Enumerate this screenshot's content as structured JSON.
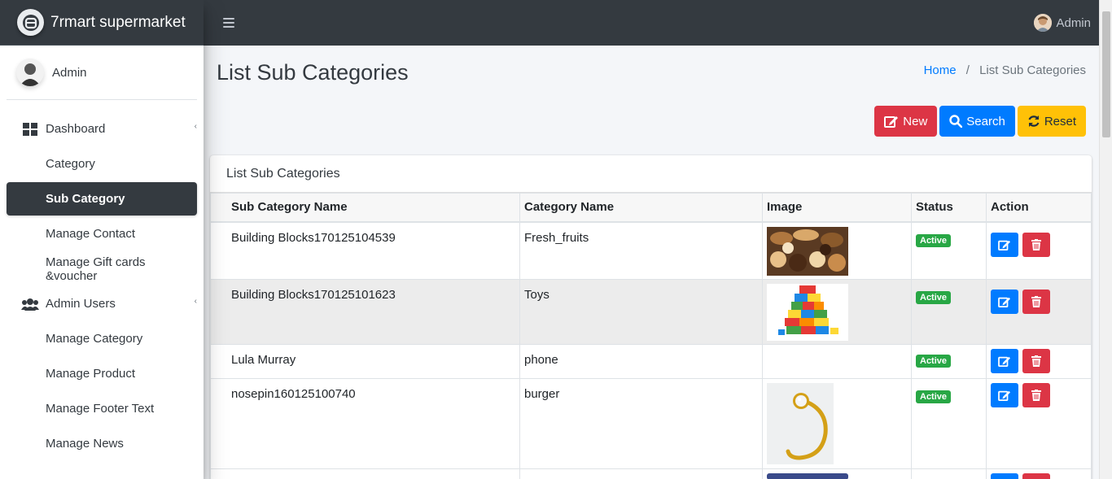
{
  "brand": {
    "name": "7rmart supermarket"
  },
  "user": {
    "name": "Admin"
  },
  "topbar": {
    "user_name": "Admin"
  },
  "sidebar": {
    "items": [
      {
        "label": "Dashboard",
        "type": "parent",
        "icon": "dashboard-icon"
      },
      {
        "label": "Category",
        "type": "child"
      },
      {
        "label": "Sub Category",
        "type": "child",
        "active": true
      },
      {
        "label": "Manage Contact",
        "type": "child"
      },
      {
        "label": "Manage Gift cards &voucher",
        "type": "child"
      },
      {
        "label": "Admin Users",
        "type": "parent",
        "icon": "users-icon"
      },
      {
        "label": "Manage Category",
        "type": "child"
      },
      {
        "label": "Manage Product",
        "type": "child"
      },
      {
        "label": "Manage Footer Text",
        "type": "child"
      },
      {
        "label": "Manage News",
        "type": "child"
      }
    ]
  },
  "page": {
    "title": "List Sub Categories",
    "breadcrumb": {
      "home": "Home",
      "separator": "/",
      "current": "List Sub Categories"
    }
  },
  "buttons": {
    "new": "New",
    "search": "Search",
    "reset": "Reset"
  },
  "card": {
    "title": "List Sub Categories",
    "columns": [
      "Sub Category Name",
      "Category Name",
      "Image",
      "Status",
      "Action"
    ],
    "rows": [
      {
        "sub_category": "Building Blocks170125104539",
        "category": "Fresh_fruits",
        "image": "cookies-image",
        "status": "Active"
      },
      {
        "sub_category": "Building Blocks170125101623",
        "category": "Toys",
        "image": "blocks-image",
        "status": "Active"
      },
      {
        "sub_category": "Lula Murray",
        "category": "phone",
        "image": "",
        "status": "Active"
      },
      {
        "sub_category": "nosepin160125100740",
        "category": "burger",
        "image": "nosepin-image",
        "status": "Active"
      }
    ]
  },
  "colors": {
    "sidebar_active": "#343a40",
    "new": "#dc3545",
    "search": "#007bff",
    "reset": "#ffc107",
    "active_badge": "#28a745"
  }
}
